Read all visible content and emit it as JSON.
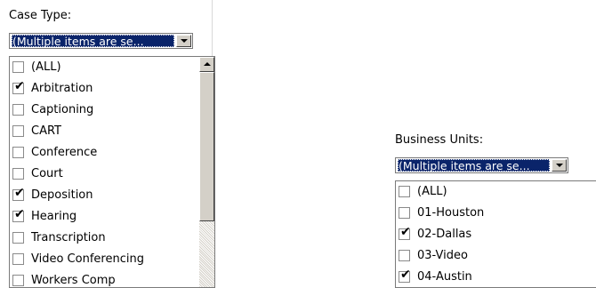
{
  "case_type": {
    "label": "Case Type:",
    "selected_text": "(Multiple items are se...",
    "items": [
      {
        "label": "(ALL)",
        "checked": false
      },
      {
        "label": "Arbitration",
        "checked": true
      },
      {
        "label": "Captioning",
        "checked": false
      },
      {
        "label": "CART",
        "checked": false
      },
      {
        "label": "Conference",
        "checked": false
      },
      {
        "label": "Court",
        "checked": false
      },
      {
        "label": "Deposition",
        "checked": true
      },
      {
        "label": "Hearing",
        "checked": true
      },
      {
        "label": "Transcription",
        "checked": false
      },
      {
        "label": "Video Conferencing",
        "checked": false
      },
      {
        "label": "Workers Comp",
        "checked": false
      }
    ]
  },
  "business_units": {
    "label": "Business Units:",
    "selected_text": "(Multiple items are se...",
    "items": [
      {
        "label": "(ALL)",
        "checked": false
      },
      {
        "label": "01-Houston",
        "checked": false
      },
      {
        "label": "02-Dallas",
        "checked": true
      },
      {
        "label": "03-Video",
        "checked": false
      },
      {
        "label": "04-Austin",
        "checked": true
      }
    ]
  },
  "colors": {
    "selection": "#0a246a",
    "control_face": "#d4d0c8",
    "border": "#7a7a7a"
  },
  "icons": {
    "dropdown": "chevron-down-icon",
    "scroll_up": "arrow-up-icon",
    "check": "checkmark-icon"
  }
}
